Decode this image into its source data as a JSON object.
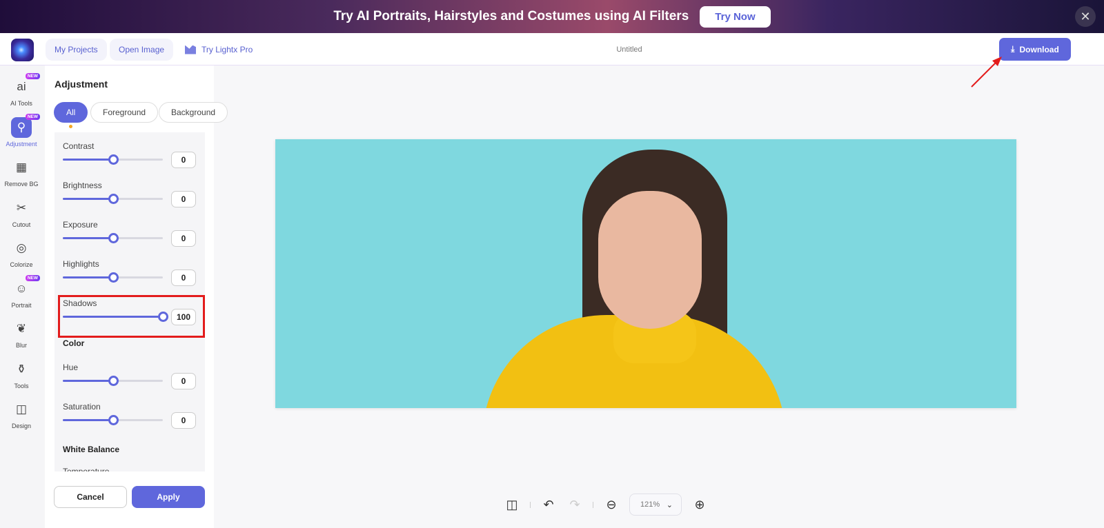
{
  "banner": {
    "text": "Try AI Portraits, Hairstyles and Costumes using AI Filters",
    "button": "Try Now",
    "close": "✕"
  },
  "header": {
    "my_projects": "My Projects",
    "open_image": "Open Image",
    "try_pro": "Try Lightx Pro",
    "title": "Untitled",
    "download": "Download"
  },
  "rail": [
    {
      "label": "AI Tools",
      "icon": "ai",
      "badge": "NEW"
    },
    {
      "label": "Adjustment",
      "icon": "⚲",
      "badge": "NEW"
    },
    {
      "label": "Remove BG",
      "icon": "▦"
    },
    {
      "label": "Cutout",
      "icon": "✂"
    },
    {
      "label": "Colorize",
      "icon": "◎"
    },
    {
      "label": "Portrait",
      "icon": "☺",
      "badge": "NEW"
    },
    {
      "label": "Blur",
      "icon": "❦"
    },
    {
      "label": "Tools",
      "icon": "⚱"
    },
    {
      "label": "Design",
      "icon": "◫"
    }
  ],
  "panel": {
    "title": "Adjustment",
    "tabs": [
      "All",
      "Foreground",
      "Background"
    ],
    "sliders": [
      {
        "label": "Contrast",
        "value": 0
      },
      {
        "label": "Brightness",
        "value": 0
      },
      {
        "label": "Exposure",
        "value": 0
      },
      {
        "label": "Highlights",
        "value": 0
      },
      {
        "label": "Shadows",
        "value": 100
      }
    ],
    "color_section": "Color",
    "color_sliders": [
      {
        "label": "Hue",
        "value": 0
      },
      {
        "label": "Saturation",
        "value": 0
      }
    ],
    "wb_section": "White Balance",
    "wb_first": "Temperature",
    "cancel": "Cancel",
    "apply": "Apply"
  },
  "toolbar": {
    "zoom": "121%"
  },
  "colors": {
    "accent": "#5f67dc",
    "highlight": "#e31c1c"
  }
}
